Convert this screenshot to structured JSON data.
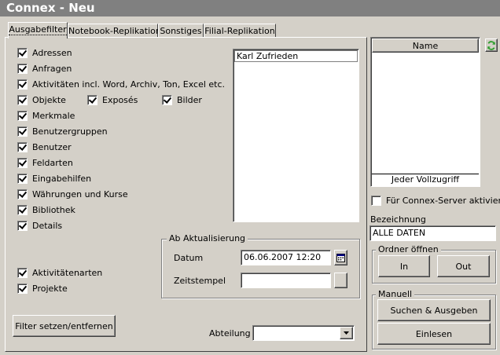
{
  "window": {
    "title": "Connex - Neu"
  },
  "tabs": [
    {
      "label": "Ausgabefilter",
      "active": true
    },
    {
      "label": "Notebook-Replikation",
      "active": false
    },
    {
      "label": "Sonstiges",
      "active": false
    },
    {
      "label": "Filial-Replikation",
      "active": false
    }
  ],
  "filters": {
    "adressen": "Adressen",
    "anfragen": "Anfragen",
    "aktivitaeten": "Aktivitäten incl. Word, Archiv, Ton, Excel etc.",
    "objekte": "Objekte",
    "exposes": "Exposés",
    "bilder": "Bilder",
    "merkmale": "Merkmale",
    "benutzergruppen": "Benutzergruppen",
    "benutzer": "Benutzer",
    "feldarten": "Feldarten",
    "eingabehilfen": "Eingabehilfen",
    "waehrungen": "Währungen und Kurse",
    "bibliothek": "Bibliothek",
    "details": "Details",
    "aktivitaetenarten": "Aktivitätenarten",
    "projekte": "Projekte"
  },
  "user_list": {
    "items": [
      "Karl Zufrieden"
    ]
  },
  "update_group": {
    "legend": "Ab Aktualisierung",
    "date_label": "Datum",
    "date_value": "06.06.2007 12:20",
    "timestamp_label": "Zeitstempel",
    "timestamp_value": ""
  },
  "filter_button": "Filter setzen/entfernen",
  "department": {
    "label": "Abteilung",
    "value": ""
  },
  "rights_table": {
    "header": "Name",
    "footer": "Jeder Vollzugriff"
  },
  "server_checkbox": {
    "label": "Für Connex-Server aktiviert",
    "checked": false
  },
  "designation": {
    "label": "Bezeichnung",
    "value": "ALLE DATEN"
  },
  "open_folder": {
    "legend": "Ordner öffnen",
    "in_label": "In",
    "out_label": "Out"
  },
  "manual": {
    "legend": "Manuell",
    "search_label": "Suchen & Ausgeben",
    "read_label": "Einlesen"
  },
  "colors": {
    "title_bg": "#808080",
    "face": "#d4d0c8",
    "refresh_green": "#2e9e2e"
  }
}
